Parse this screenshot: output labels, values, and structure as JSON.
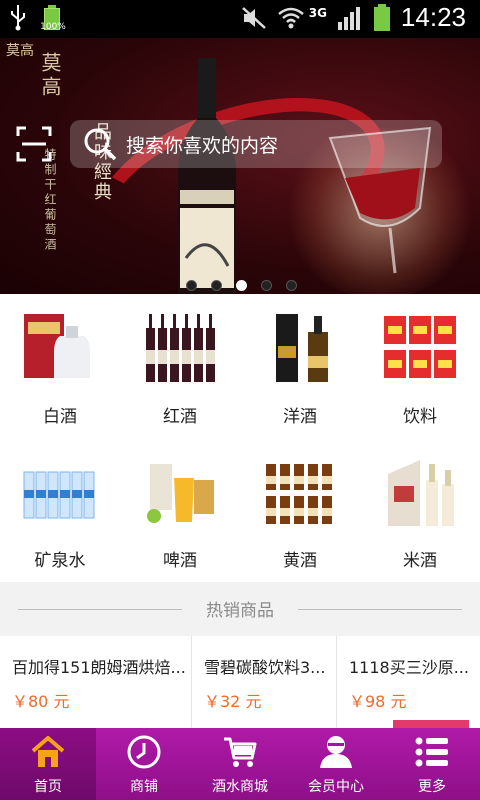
{
  "status_bar": {
    "battery_percent": "100%",
    "network": "3G",
    "time": "14:23"
  },
  "banner": {
    "brand_vertical": "莫高",
    "slogan_vertical": "品味經典",
    "subtitle_vertical": "特制干红葡萄酒",
    "corner_logo": "莫高",
    "search_placeholder": "搜索你喜欢的内容",
    "slide_count": 5,
    "active_slide": 3
  },
  "categories": [
    {
      "label": "白酒",
      "icon": "baijiu-image"
    },
    {
      "label": "红酒",
      "icon": "red-wine-image"
    },
    {
      "label": "洋酒",
      "icon": "foreign-liquor-image"
    },
    {
      "label": "饮料",
      "icon": "beverage-image"
    },
    {
      "label": "矿泉水",
      "icon": "mineral-water-image"
    },
    {
      "label": "啤酒",
      "icon": "beer-image"
    },
    {
      "label": "黄酒",
      "icon": "yellow-wine-image"
    },
    {
      "label": "米酒",
      "icon": "rice-wine-image"
    }
  ],
  "hot_section": {
    "title": "热销商品"
  },
  "products": [
    {
      "name": "百加得151朗姆酒烘焙...",
      "price": "￥80 元"
    },
    {
      "name": "雪碧碳酸饮料3...",
      "price": "￥32 元"
    },
    {
      "name": "1118买三沙原...",
      "price": "￥98 元"
    }
  ],
  "tabbar": {
    "items": [
      {
        "label": "首页",
        "icon": "home-icon",
        "active": true
      },
      {
        "label": "商铺",
        "icon": "clock-icon",
        "active": false
      },
      {
        "label": "酒水商城",
        "icon": "cart-icon",
        "active": false
      },
      {
        "label": "会员中心",
        "icon": "user-icon",
        "active": false
      },
      {
        "label": "更多",
        "icon": "more-icon",
        "active": false
      }
    ]
  },
  "colors": {
    "accent": "#a3159c",
    "price": "#f06a2a",
    "section_bg": "#f2f2f2"
  }
}
